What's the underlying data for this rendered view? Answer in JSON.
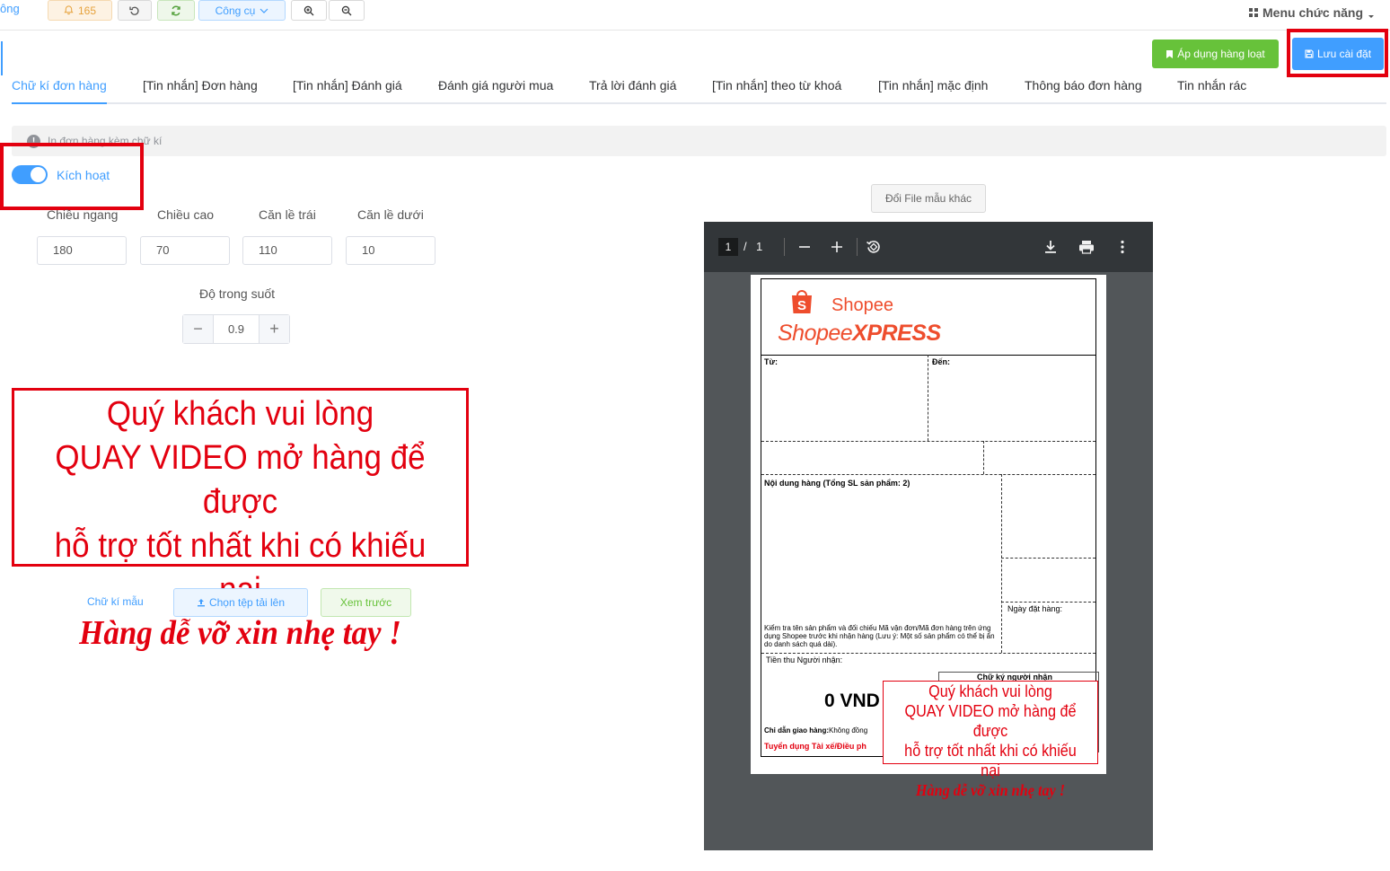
{
  "toolbar": {
    "edge_text": "ông",
    "notification_count": "165",
    "tools_label": "Công cụ",
    "menu_label": "Menu chức năng"
  },
  "actions": {
    "apply_all": "Áp dụng hàng loạt",
    "save_settings": "Lưu cài đặt"
  },
  "tabs": [
    {
      "label": "Chữ kí đơn hàng"
    },
    {
      "label": "[Tin nhắn] Đơn hàng"
    },
    {
      "label": "[Tin nhắn] Đánh giá"
    },
    {
      "label": "Đánh giá người mua"
    },
    {
      "label": "Trả lời đánh giá"
    },
    {
      "label": "[Tin nhắn] theo từ khoá"
    },
    {
      "label": "[Tin nhắn] mặc định"
    },
    {
      "label": "Thông báo đơn hàng"
    },
    {
      "label": "Tin nhắn rác"
    }
  ],
  "info_text": "In đơn hàng kèm chữ kí",
  "toggle": {
    "label": "Kích hoạt",
    "on": true
  },
  "fields": [
    {
      "label": "Chiều ngang",
      "value": "180"
    },
    {
      "label": "Chiều cao",
      "value": "70"
    },
    {
      "label": "Căn lề trái",
      "value": "110"
    },
    {
      "label": "Căn lề dưới",
      "value": "10"
    }
  ],
  "opacity": {
    "label": "Độ trong suốt",
    "value": "0.9"
  },
  "signature_lines": [
    "Quý khách vui lòng",
    "QUAY VIDEO mở hàng để được",
    "hỗ trợ tốt nhất khi có khiếu nại",
    "Hàng dễ vỡ xin nhẹ tay !"
  ],
  "buttons": {
    "sample_link": "Chữ kí mẫu",
    "upload": "Chọn tệp tải lên",
    "preview": "Xem trước",
    "change_file": "Đổi File mẫu khác"
  },
  "pdf": {
    "page_current": "1",
    "page_separator": "/",
    "page_total": "1",
    "brand": "Shopee",
    "brand_express_1": "Shopee",
    "brand_express_2": "XPRESS",
    "from_label": "Từ:",
    "to_label": "Đến:",
    "content_label": "Nội dung hàng (Tổng SL sản phẩm: 2)",
    "order_date_label": "Ngày đặt hàng:",
    "check_note": "Kiểm tra tên sản phẩm và đối chiếu Mã vận đơn/Mã đơn hàng trên ứng dụng Shopee trước khi nhận hàng (Lưu ý: Một số sản phẩm có thể bị ẩn do danh sách quá dài).",
    "cod_label": "Tiền thu Người nhận:",
    "cod_value": "0 VND",
    "recipient_sig": "Chữ ký người nhận",
    "delivery_note_label": "Chỉ dẫn giao hàng:",
    "delivery_note_value": "Không đồng",
    "recruit_text": "Tuyển dụng Tài xế/Điều ph"
  },
  "colors": {
    "primary": "#409eff",
    "success": "#67c23a",
    "highlight": "#e3000f",
    "shopee": "#ee4d2d"
  }
}
